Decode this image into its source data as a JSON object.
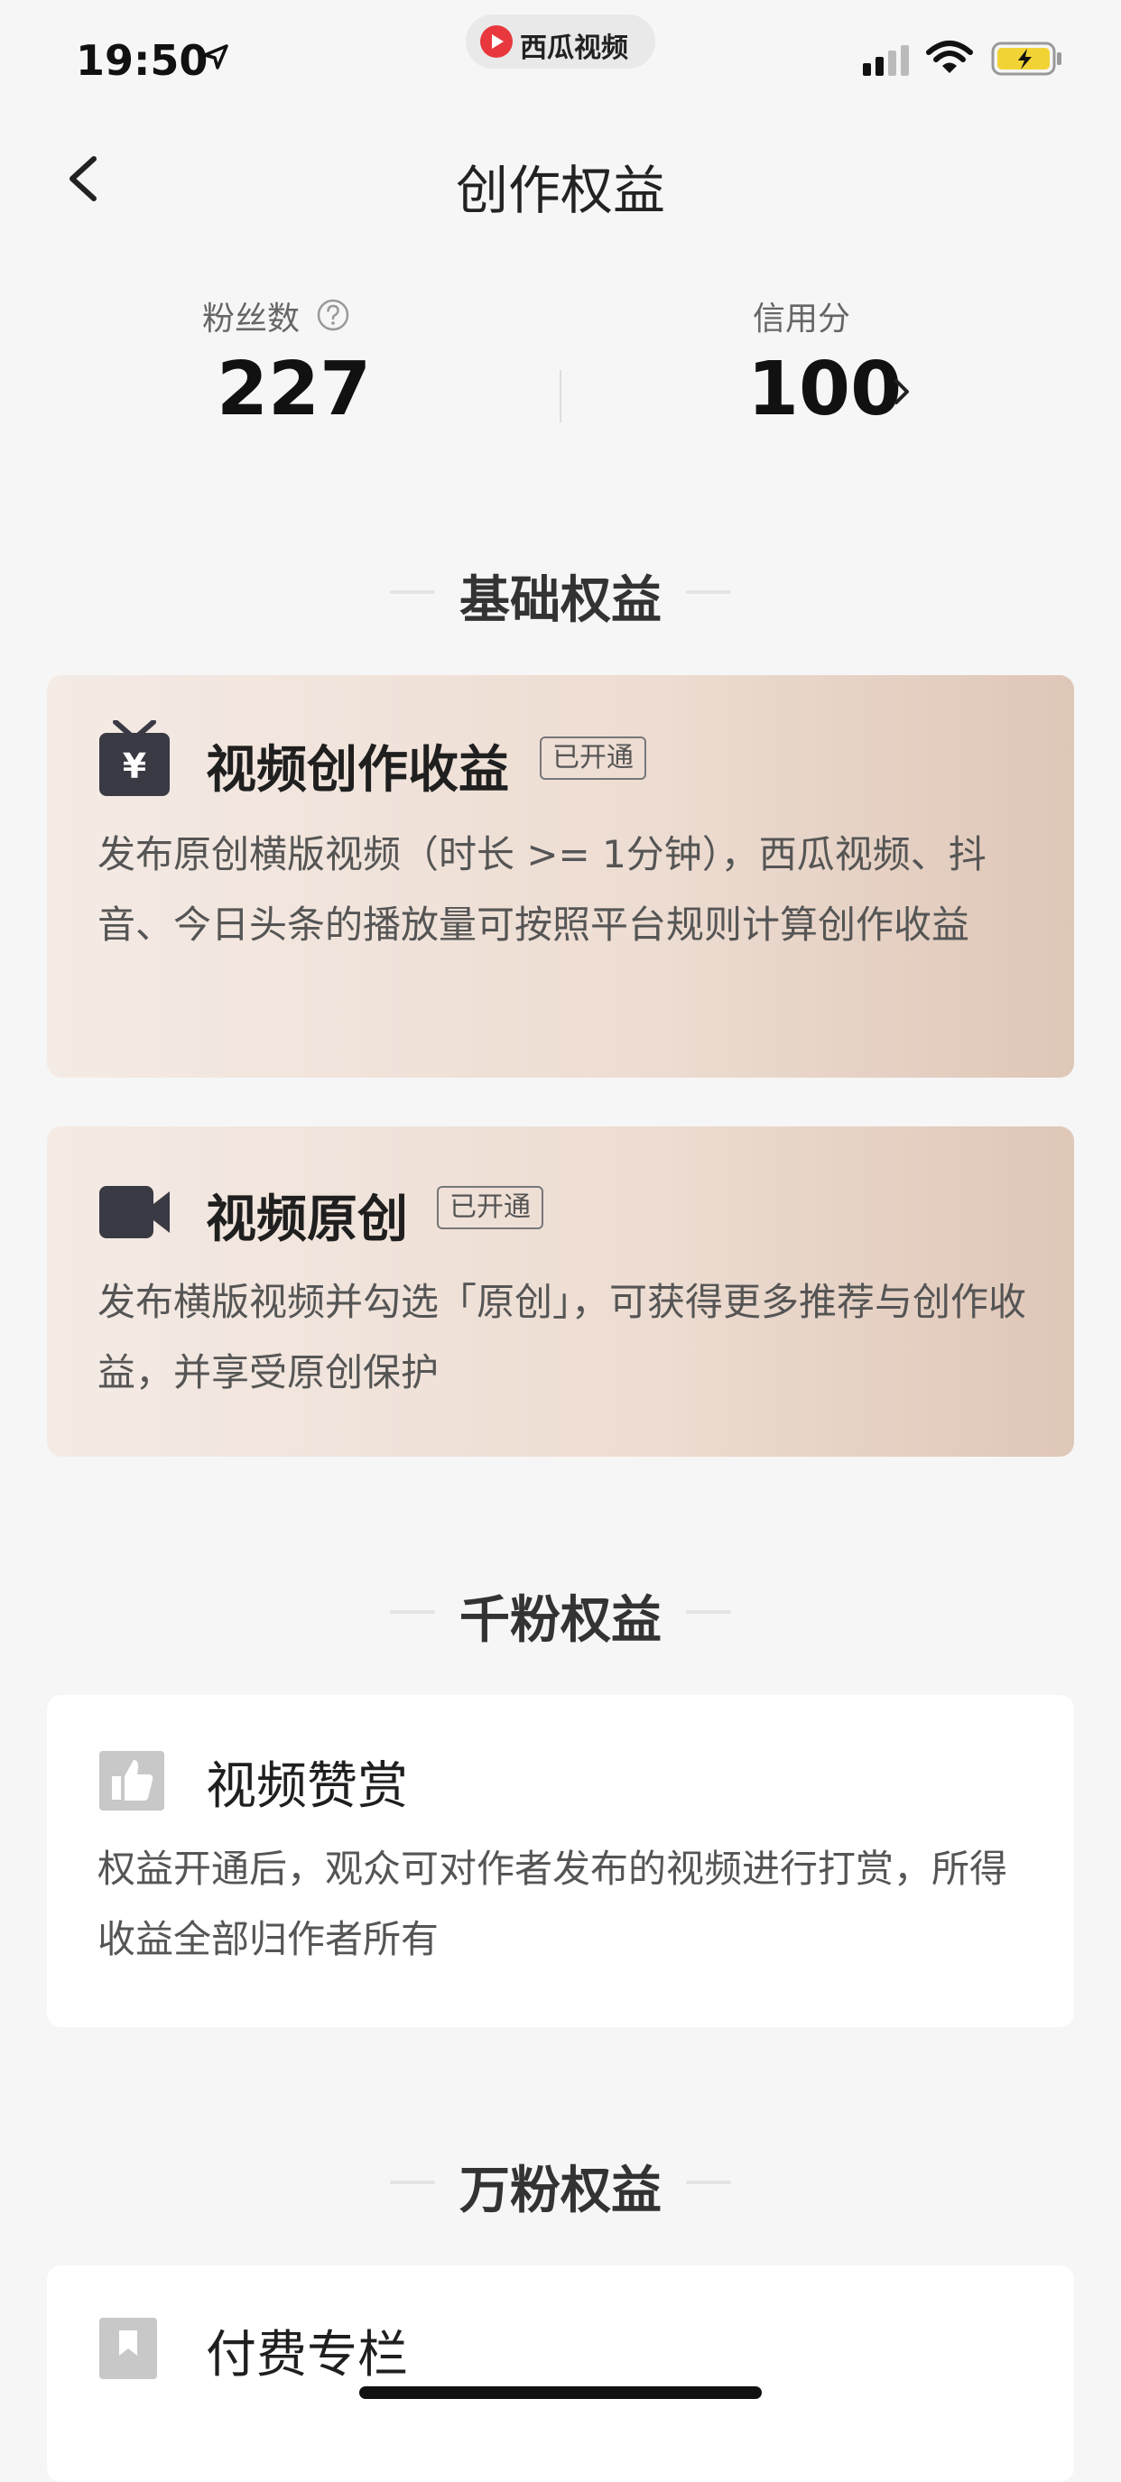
{
  "status_bar": {
    "time": "19:50",
    "app_name": "西瓜视频",
    "accent": "#e8383d"
  },
  "nav": {
    "title": "创作权益"
  },
  "stats": {
    "fans_label": "粉丝数",
    "fans_value": "227",
    "credit_label": "信用分",
    "credit_value": "100"
  },
  "sections": {
    "basic": {
      "heading": "基础权益",
      "cards": [
        {
          "icon": "tv-yuan-icon",
          "title": "视频创作收益",
          "badge": "已开通",
          "description": "发布原创横版视频（时长 >= 1分钟），西瓜视频、抖音、今日头条的播放量可按照平台规则计算创作收益"
        },
        {
          "icon": "video-camera-icon",
          "title": "视频原创",
          "badge": "已开通",
          "description": "发布横版视频并勾选「原创」，可获得更多推荐与创作收益，并享受原创保护"
        }
      ]
    },
    "thousand_fans": {
      "heading": "千粉权益",
      "cards": [
        {
          "icon": "thumbs-up-icon",
          "title": "视频赞赏",
          "description": "权益开通后，观众可对作者发布的视频进行打赏，所得收益全部归作者所有"
        }
      ]
    },
    "ten_thousand_fans": {
      "heading": "万粉权益",
      "cards": [
        {
          "icon": "paid-column-icon",
          "title": "付费专栏"
        }
      ]
    }
  }
}
